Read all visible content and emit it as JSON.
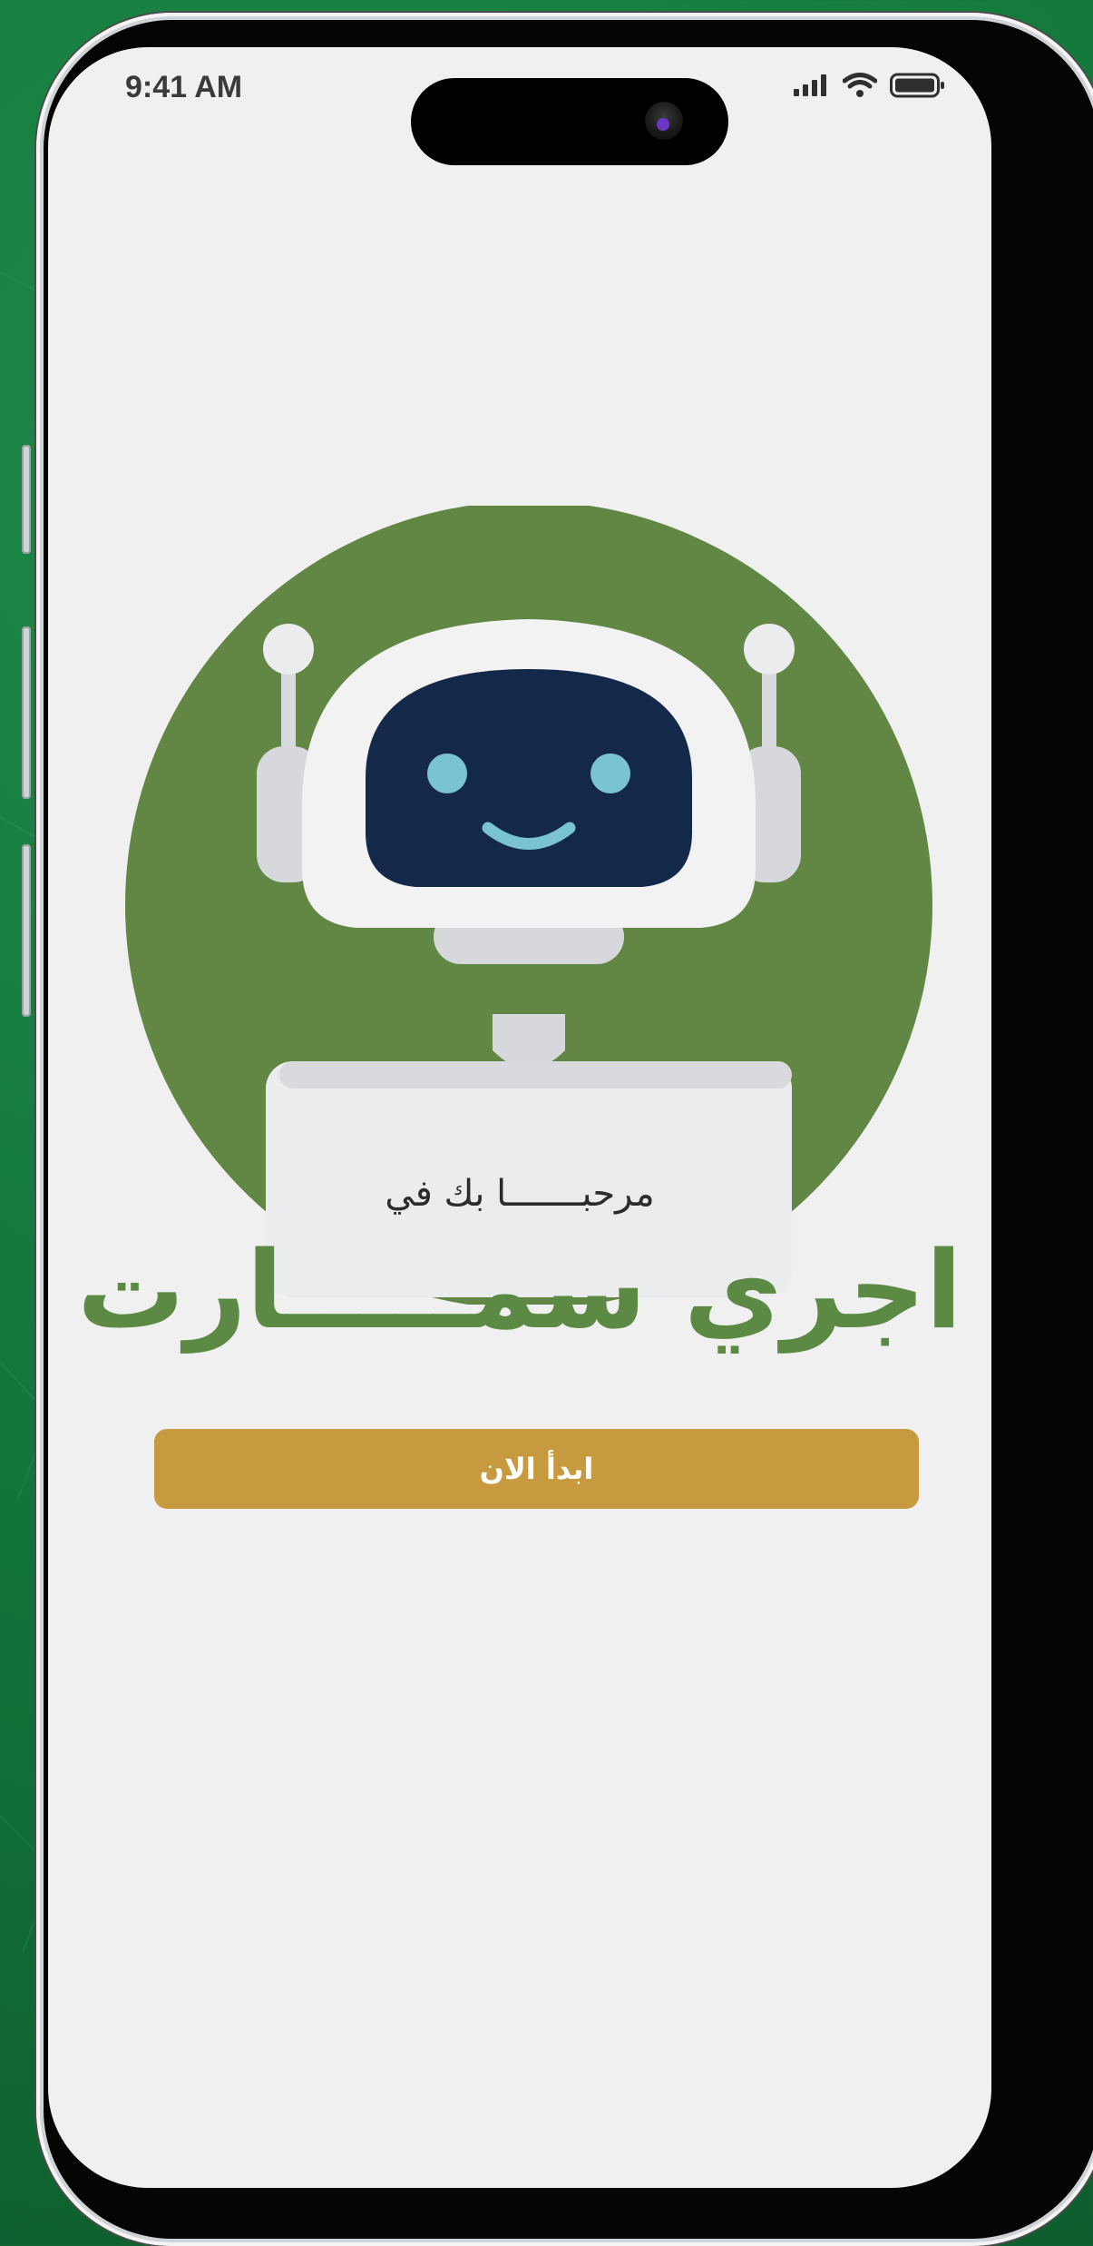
{
  "status_bar": {
    "time": "9:41 AM",
    "icons": [
      "signal-icon",
      "wifi-icon",
      "battery-icon"
    ]
  },
  "welcome": {
    "subtitle": "مرحبـــــــا بك في",
    "brand_name": "اجري سمـــــارت"
  },
  "cta": {
    "label": "ابدأ الان"
  },
  "colors": {
    "background_green": "#137a3c",
    "circle_green": "#628745",
    "brand_text": "#5c8a44",
    "button_gold": "#c79a3f",
    "screen_bg": "#f0f0f0",
    "robot_face": "#14284a",
    "robot_eyes": "#79c3d4"
  }
}
